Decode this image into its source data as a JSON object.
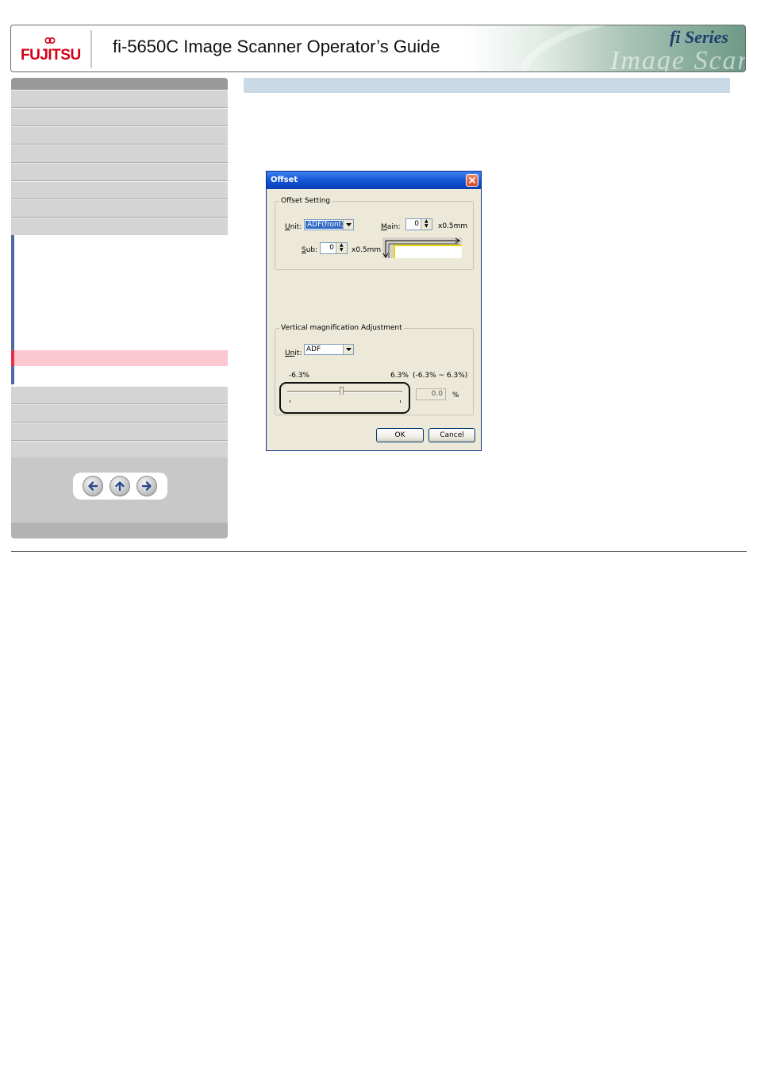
{
  "header": {
    "brand": "FUJITSU",
    "title": "fi-5650C Image Scanner Operator’s Guide",
    "series_logo": "fi Series",
    "watermark": "Image Scanner"
  },
  "sidebar": {
    "top_items": [
      "",
      "",
      "",
      "",
      "",
      "",
      "",
      ""
    ],
    "bottom_items": [
      "",
      "",
      "",
      ""
    ],
    "nav_buttons": [
      {
        "icon": "arrow-left-icon"
      },
      {
        "icon": "arrow-up-icon"
      },
      {
        "icon": "arrow-right-icon"
      }
    ]
  },
  "dialog": {
    "title": "Offset",
    "offset_group": {
      "label": "Offset Setting",
      "unit_label_prefix": "U",
      "unit_label_rest": "nit:",
      "unit_value": "ADF(front)",
      "main_label_prefix": "M",
      "main_label_rest": "ain:",
      "main_value": "0",
      "main_unit": "x0.5mm",
      "sub_label_prefix": "S",
      "sub_label_rest": "ub:",
      "sub_value": "0",
      "sub_unit": "x0.5mm"
    },
    "vertical_group": {
      "label": "Vertical magnification Adjustment",
      "unit_label_prefix": "Un",
      "unit_label_rest": "it:",
      "unit_value": "ADF",
      "min_label": "-6.3%",
      "max_label": "6.3%",
      "range_label": "(-6.3% ~ 6.3%)",
      "value": "0.0",
      "value_unit": "%"
    },
    "ok_label": "OK",
    "cancel_label": "Cancel"
  },
  "colors": {
    "brand_red": "#d40015",
    "active_nav": "#fbc7d1",
    "content_bar": "#c9d9e5",
    "xp_title": "#0a46c8"
  }
}
